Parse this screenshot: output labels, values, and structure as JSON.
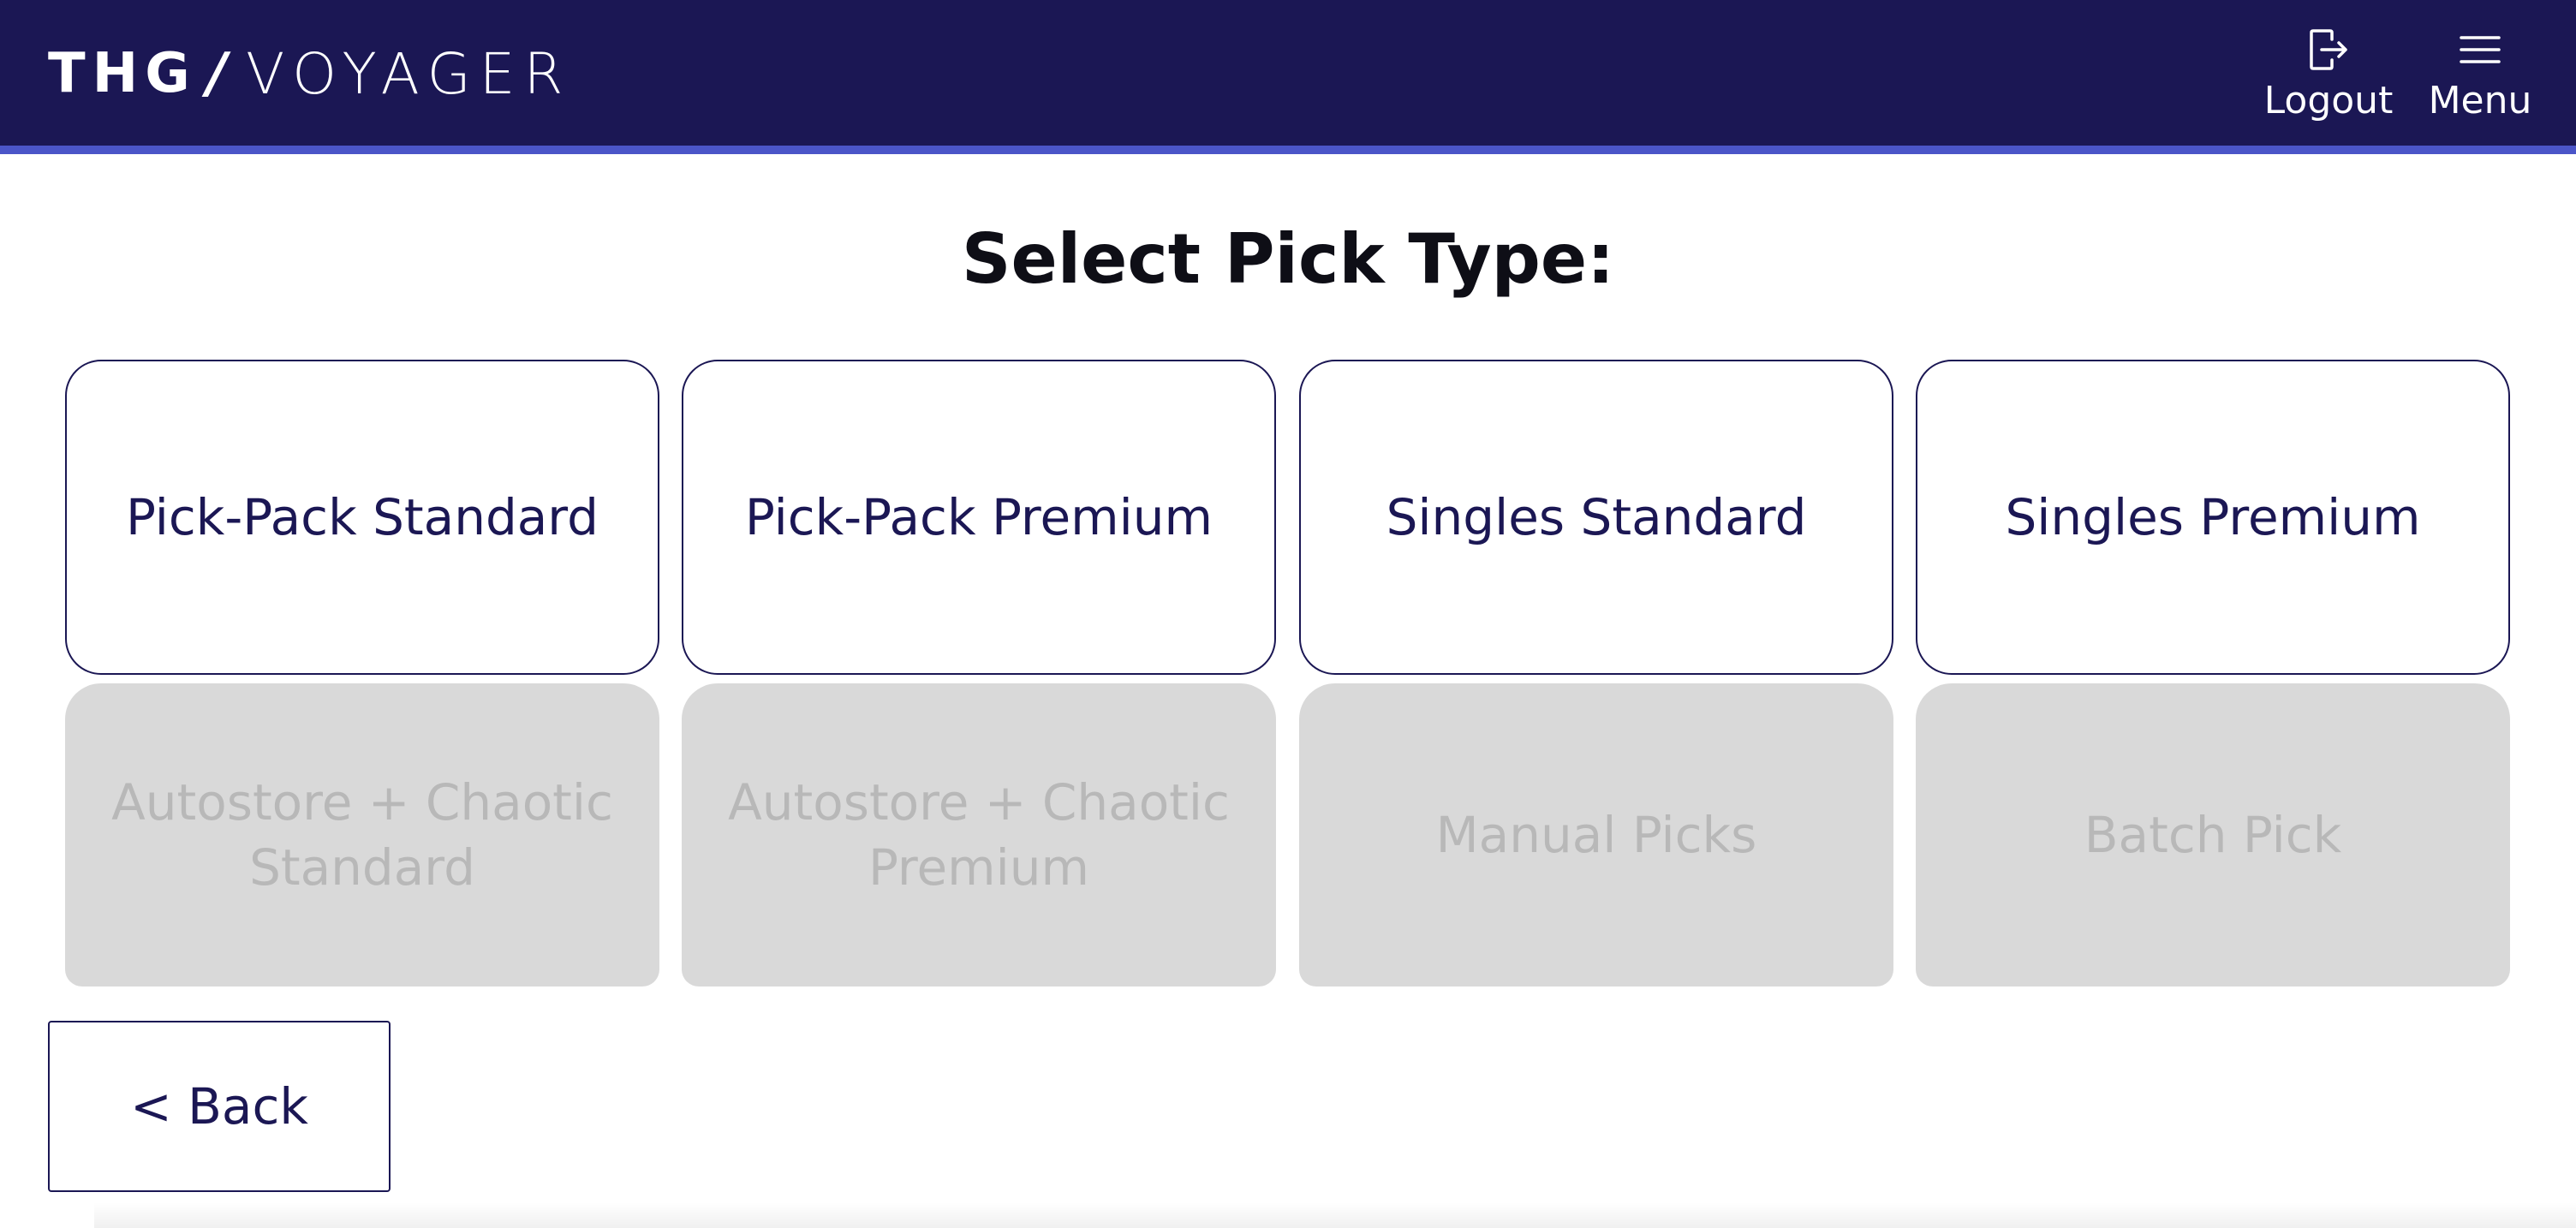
{
  "header": {
    "brand": {
      "left": "THG",
      "slash": "/",
      "right": "VOYAGER"
    },
    "logout": {
      "label": "Logout",
      "icon": "logout-icon"
    },
    "menu": {
      "label": "Menu",
      "icon": "hamburger-menu-icon"
    },
    "colors": {
      "background": "#1b1754",
      "accent_bar": "#4b55c8",
      "text": "#ffffff"
    }
  },
  "main": {
    "title": "Select Pick Type:",
    "pick_types": [
      {
        "label": "Pick-Pack Standard",
        "enabled": true
      },
      {
        "label": "Pick-Pack Premium",
        "enabled": true
      },
      {
        "label": "Singles Standard",
        "enabled": true
      },
      {
        "label": "Singles Premium",
        "enabled": true
      },
      {
        "label": "Autostore + Chaotic Standard",
        "enabled": false
      },
      {
        "label": "Autostore + Chaotic Premium",
        "enabled": false
      },
      {
        "label": "Manual Picks",
        "enabled": false
      },
      {
        "label": "Batch Pick",
        "enabled": false
      }
    ],
    "back_label": "< Back"
  },
  "colors": {
    "primary": "#1b1754",
    "disabled_bg": "#d9d9d9",
    "disabled_text": "#b8b8b8"
  }
}
